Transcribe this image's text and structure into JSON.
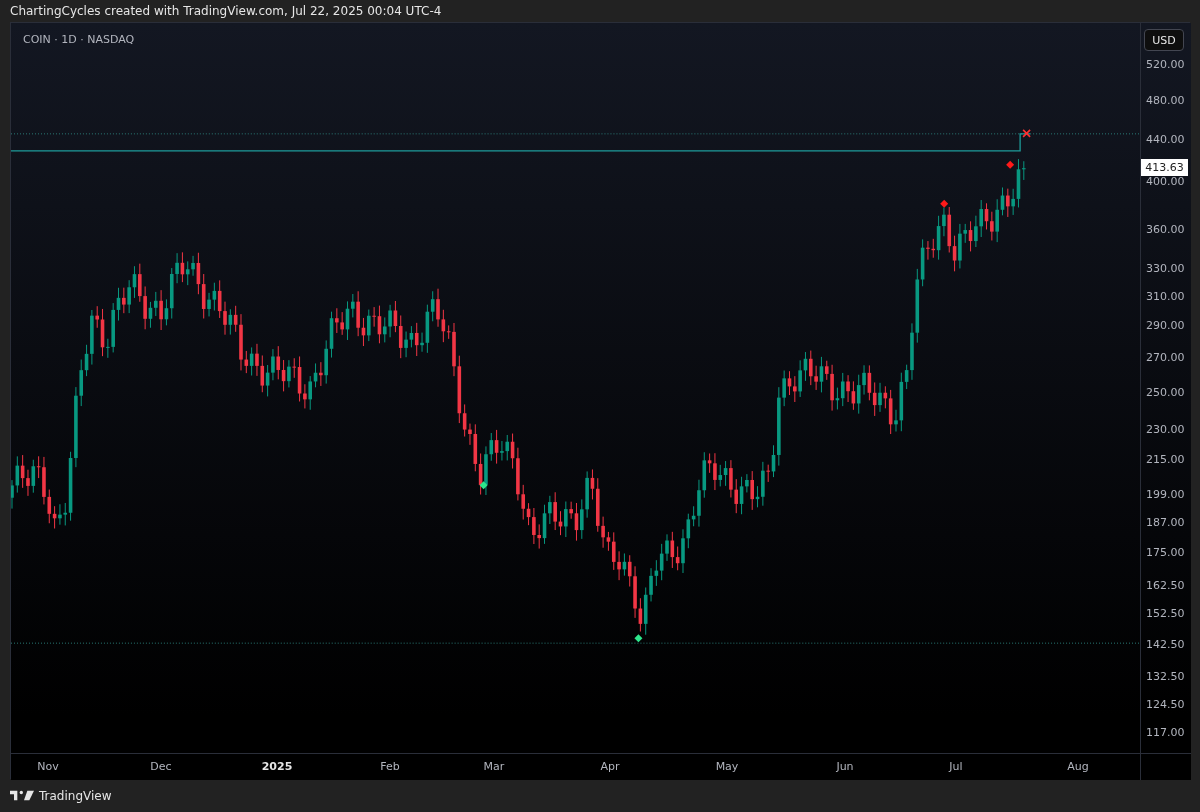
{
  "header": {
    "caption": "ChartingCycles created with TradingView.com, Jul 22, 2025 00:04 UTC-4"
  },
  "chart": {
    "legend": "COIN · 1D · NASDAQ",
    "currency_button": "USD",
    "last_price": "413.63",
    "price_ticks": [
      "520.00",
      "480.00",
      "440.00",
      "400.00",
      "360.00",
      "330.00",
      "310.00",
      "290.00",
      "270.00",
      "250.00",
      "230.00",
      "215.00",
      "199.00",
      "187.00",
      "175.00",
      "162.50",
      "152.50",
      "142.50",
      "132.50",
      "124.50",
      "117.00"
    ],
    "time_ticks": [
      {
        "label": "Nov",
        "bold": false
      },
      {
        "label": "Dec",
        "bold": false
      },
      {
        "label": "2025",
        "bold": true
      },
      {
        "label": "Feb",
        "bold": false
      },
      {
        "label": "Mar",
        "bold": false
      },
      {
        "label": "Apr",
        "bold": false
      },
      {
        "label": "May",
        "bold": false
      },
      {
        "label": "Jun",
        "bold": false
      },
      {
        "label": "Jul",
        "bold": false
      },
      {
        "label": "Aug",
        "bold": false
      }
    ]
  },
  "footer": {
    "brand": "TradingView"
  }
}
